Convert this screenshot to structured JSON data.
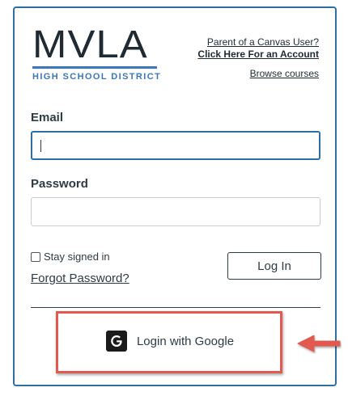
{
  "logo": {
    "main": "MVLA",
    "sub": "HIGH SCHOOL DISTRICT"
  },
  "links": {
    "parent_question": "Parent of a Canvas User?",
    "create_account": "Click Here For an Account",
    "browse": "Browse courses"
  },
  "form": {
    "email_label": "Email",
    "email_value": "",
    "password_label": "Password",
    "password_value": "",
    "stay_signed_in": "Stay signed in",
    "forgot": "Forgot Password?",
    "login": "Log In",
    "google": "Login with Google"
  },
  "icons": {
    "google": "google-g-icon",
    "arrow": "arrow-left-icon"
  },
  "colors": {
    "accent": "#2d6fa3",
    "brand_blue": "#3b78b8",
    "highlight": "#e25a4f",
    "text": "#2d3b45"
  }
}
